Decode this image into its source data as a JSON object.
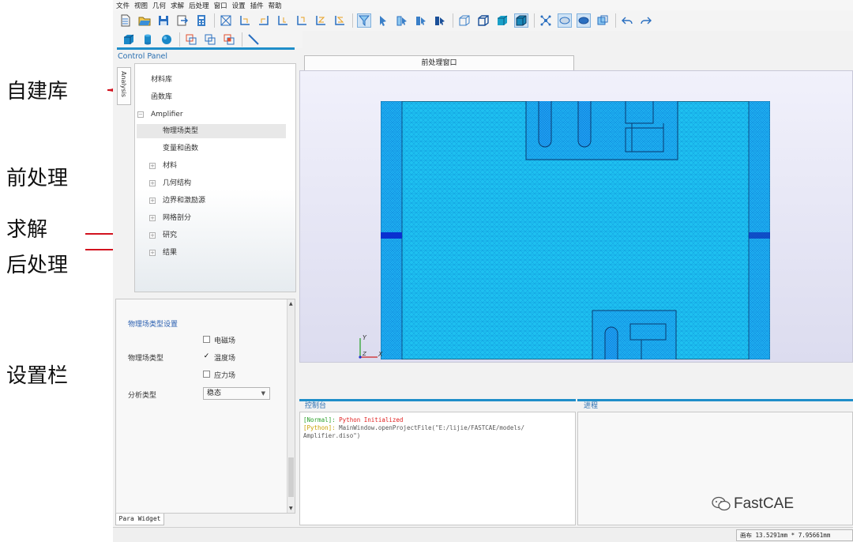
{
  "annotations": {
    "library": "自建库",
    "preprocess": "前处理",
    "solve": "求解",
    "postprocess": "后处理",
    "settings": "设置栏"
  },
  "menu": [
    "文件",
    "视图",
    "几何",
    "求解",
    "后处理",
    "窗口",
    "设置",
    "插件",
    "帮助"
  ],
  "control_panel": {
    "title": "Control Panel",
    "vertical_tab": "Analysis",
    "tree": {
      "material_lib": "材料库",
      "function_lib": "函数库",
      "project": "Amplifier",
      "physics_type": "物理场类型",
      "variables": "变量和函数",
      "materials": "材料",
      "geometry": "几何结构",
      "boundary": "边界和激励源",
      "mesh": "网格剖分",
      "study": "研究",
      "results": "结果"
    }
  },
  "settings_panel": {
    "title": "物理场类型设置",
    "physics_label": "物理场类型",
    "options": [
      {
        "label": "电磁场",
        "checked": false
      },
      {
        "label": "温度场",
        "checked": true
      },
      {
        "label": "应力场",
        "checked": false
      }
    ],
    "analysis_label": "分析类型",
    "analysis_value": "稳态",
    "tab": "Para Widget"
  },
  "view": {
    "tab": "前处理窗口",
    "axis_y": "Y",
    "axis_x": "X",
    "axis_z": "Z"
  },
  "console": {
    "title": "控制台",
    "line1_tag": "[Normal]:",
    "line1_msg": "Python Initialized",
    "line2_tag": "[Python]:",
    "line2_msg": "MainWindow.openProjectFile(\"E:/lijie/FASTCAE/models/",
    "line3_msg": "Amplifier.diso\")"
  },
  "progress": {
    "title": "进程"
  },
  "watermark": "FastCAE",
  "status": {
    "canvas_size": "画布 13.5291mm * 7.95661mm"
  },
  "colors": {
    "accent": "#1f8ec9",
    "mesh_fill": "#1ec0f0",
    "mesh_edge": "#0a4bd8",
    "normal_tag": "#2aa02a",
    "python_tag": "#c8a000",
    "error_text": "#e02020"
  }
}
